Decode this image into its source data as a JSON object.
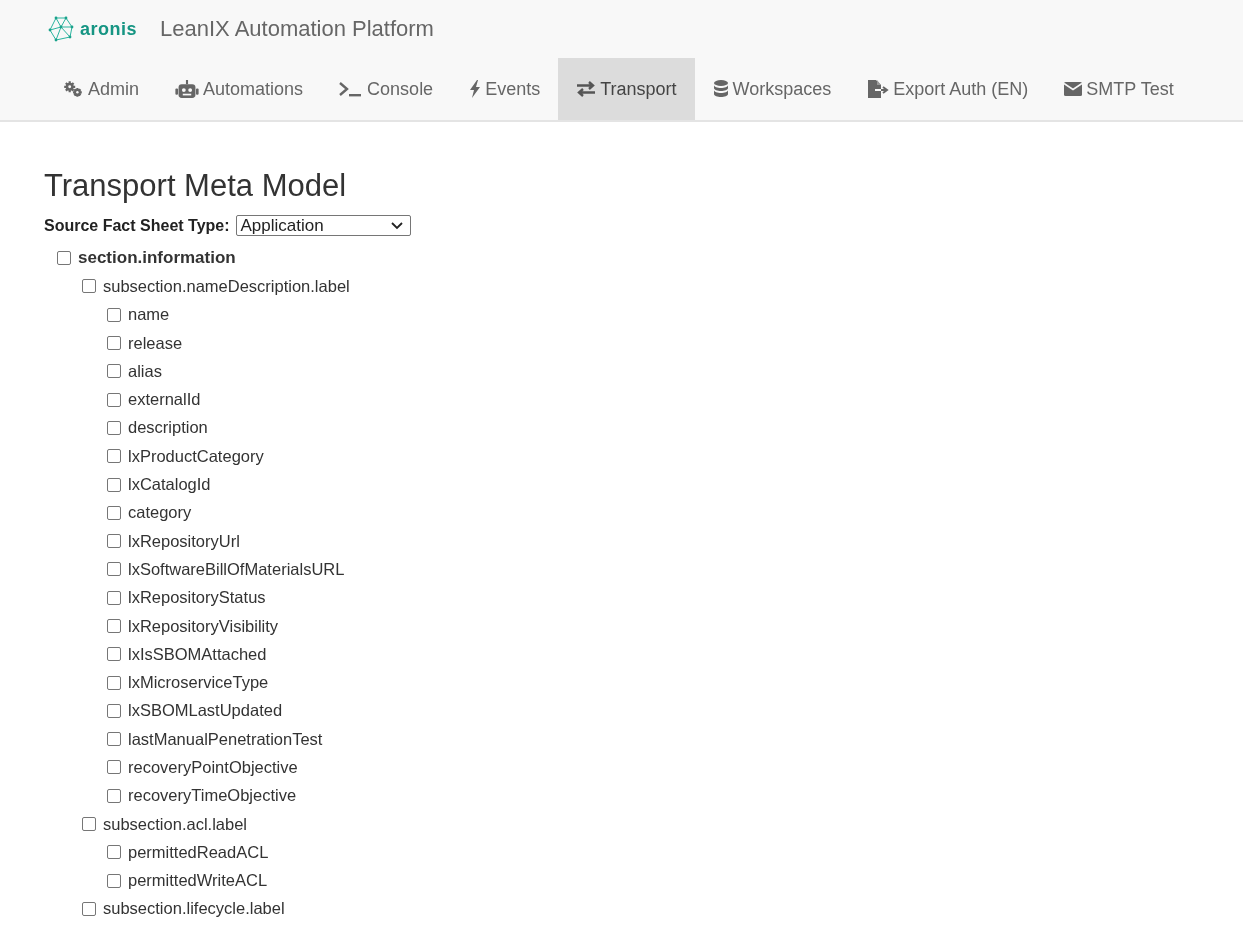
{
  "header": {
    "logo_text": "aronis",
    "title": "LeanIX Automation Platform"
  },
  "tabs": [
    {
      "label": "Admin",
      "selected": false
    },
    {
      "label": "Automations",
      "selected": false
    },
    {
      "label": "Console",
      "selected": false
    },
    {
      "label": "Events",
      "selected": false
    },
    {
      "label": "Transport",
      "selected": true
    },
    {
      "label": "Workspaces",
      "selected": false
    },
    {
      "label": "Export Auth (EN)",
      "selected": false
    },
    {
      "label": "SMTP Test",
      "selected": false
    }
  ],
  "page": {
    "heading": "Transport Meta Model",
    "source_label": "Source Fact Sheet Type:",
    "source_value": "Application"
  },
  "tree": [
    {
      "label": "section.information",
      "checked": false,
      "children": [
        {
          "label": "subsection.nameDescription.label",
          "checked": false,
          "children": [
            {
              "label": "name",
              "checked": false
            },
            {
              "label": "release",
              "checked": false
            },
            {
              "label": "alias",
              "checked": false
            },
            {
              "label": "externalId",
              "checked": false
            },
            {
              "label": "description",
              "checked": false
            },
            {
              "label": "lxProductCategory",
              "checked": false
            },
            {
              "label": "lxCatalogId",
              "checked": false
            },
            {
              "label": "category",
              "checked": false
            },
            {
              "label": "lxRepositoryUrl",
              "checked": false
            },
            {
              "label": "lxSoftwareBillOfMaterialsURL",
              "checked": false
            },
            {
              "label": "lxRepositoryStatus",
              "checked": false
            },
            {
              "label": "lxRepositoryVisibility",
              "checked": false
            },
            {
              "label": "lxIsSBOMAttached",
              "checked": false
            },
            {
              "label": "lxMicroserviceType",
              "checked": false
            },
            {
              "label": "lxSBOMLastUpdated",
              "checked": false
            },
            {
              "label": "lastManualPenetrationTest",
              "checked": false
            },
            {
              "label": "recoveryPointObjective",
              "checked": false
            },
            {
              "label": "recoveryTimeObjective",
              "checked": false
            }
          ]
        },
        {
          "label": "subsection.acl.label",
          "checked": false,
          "children": [
            {
              "label": "permittedReadACL",
              "checked": false
            },
            {
              "label": "permittedWriteACL",
              "checked": false
            }
          ]
        },
        {
          "label": "subsection.lifecycle.label",
          "checked": false
        }
      ]
    }
  ]
}
